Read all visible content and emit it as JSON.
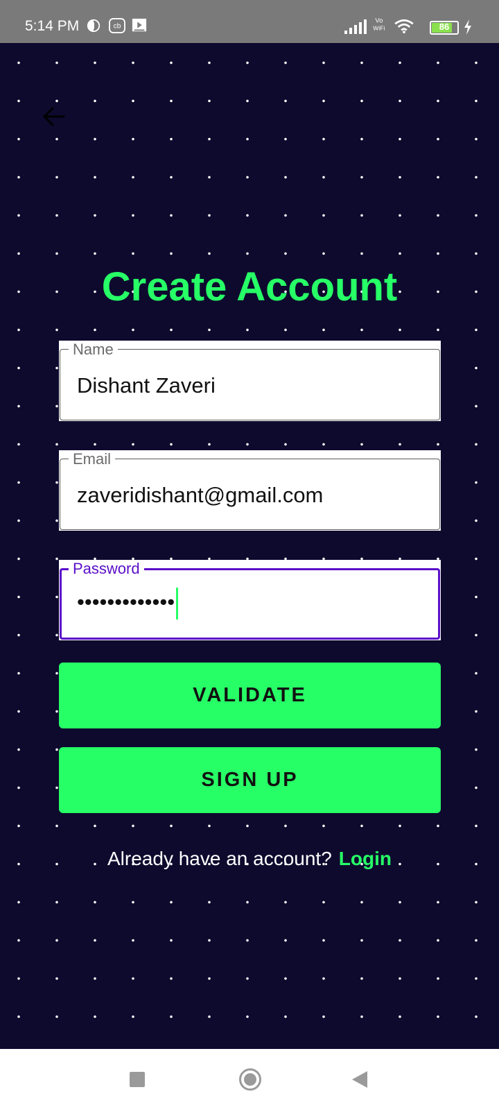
{
  "status_bar": {
    "time": "5:14 PM",
    "battery": "86",
    "icons": [
      "notification-icon",
      "cb-icon",
      "media-icon",
      "signal-icon",
      "vowifi-icon",
      "wifi-icon",
      "battery-icon",
      "charging-icon"
    ],
    "vowifi_top": "Vo",
    "vowifi_bottom": "WiFi",
    "cb_text": "cb"
  },
  "page": {
    "title": "Create Account",
    "accent_color": "#27ff66",
    "background_color": "#0e0a2e",
    "focus_color": "#5a0fc8"
  },
  "form": {
    "name": {
      "label": "Name",
      "value": "Dishant Zaveri"
    },
    "email": {
      "label": "Email",
      "value": "zaveridishant@gmail.com"
    },
    "password": {
      "label": "Password",
      "value": "•••••••••••••"
    }
  },
  "buttons": {
    "validate": "VALIDATE",
    "signup": "SIGN UP"
  },
  "footer": {
    "prompt": "Already have an account?",
    "login": "Login"
  },
  "nav": {
    "icons": [
      "recents-icon",
      "home-icon",
      "back-icon"
    ]
  }
}
